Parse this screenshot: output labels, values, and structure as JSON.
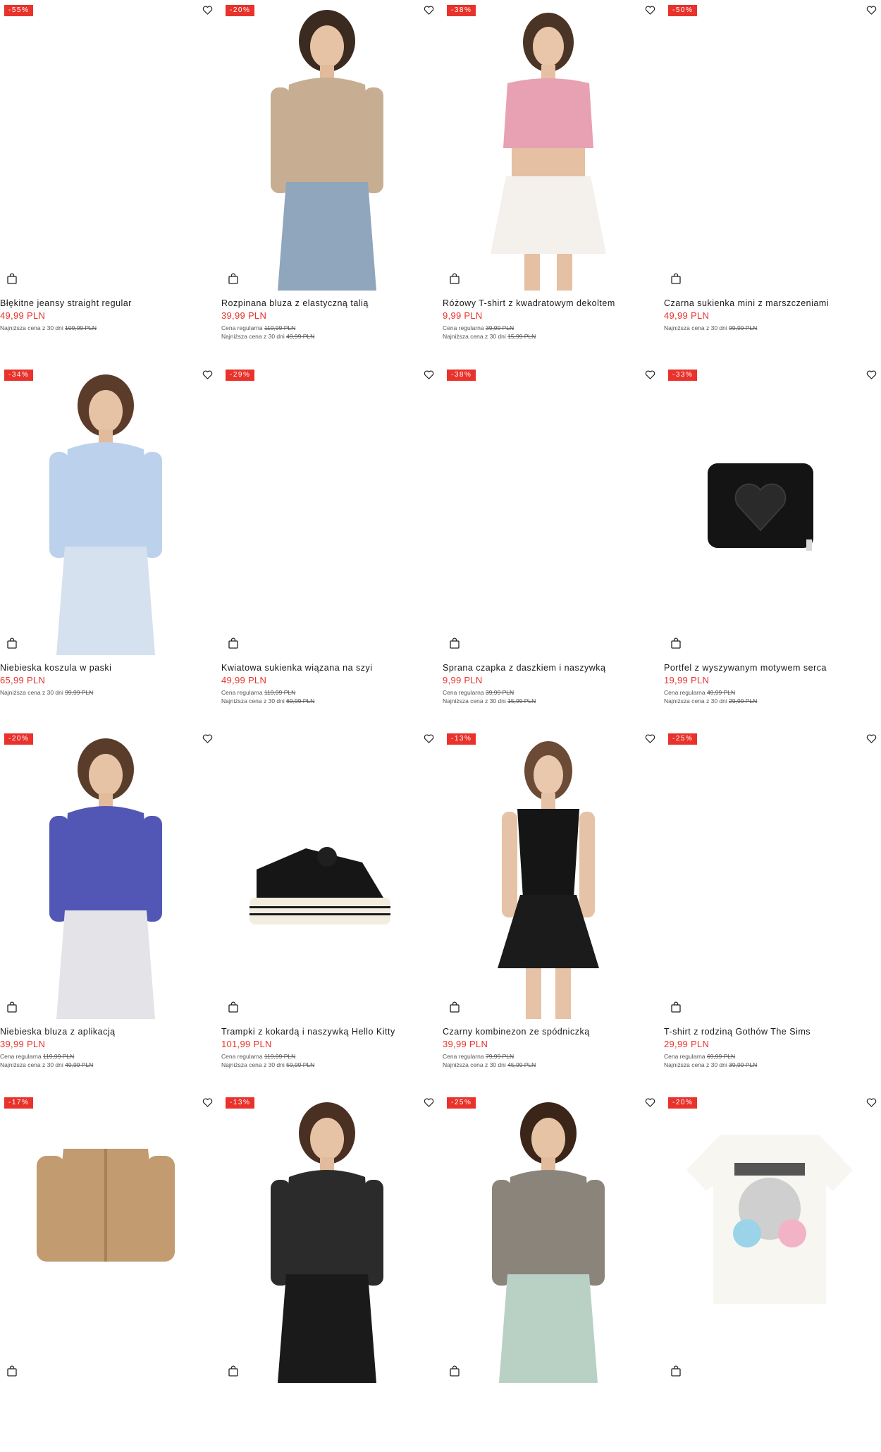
{
  "colors": {
    "sale": "#e8322b",
    "text": "#1a1a1a",
    "muted": "#555555"
  },
  "icons": {
    "favorite": "heart-outline-icon",
    "cart": "shopping-bag-icon"
  },
  "products": [
    {
      "badge": "-55%",
      "title": "Błękitne jeansy straight regular",
      "price": "49,99 PLN",
      "regular_label": "",
      "regular_price": "",
      "lowest_label": "Najniższa cena z 30 dni",
      "lowest_price": "109,99 PLN",
      "image": "empty"
    },
    {
      "badge": "-20%",
      "title": "Rozpinana bluza z elastyczną talią",
      "price": "39,99 PLN",
      "regular_label": "Cena regularna",
      "regular_price": "119,99 PLN",
      "lowest_label": "Najniższa cena z 30 dni",
      "lowest_price": "49,99 PLN",
      "image": "hoodie-model"
    },
    {
      "badge": "-38%",
      "title": "Różowy T-shirt z kwadratowym dekoltem",
      "price": "9,99 PLN",
      "regular_label": "Cena regularna",
      "regular_price": "39,99 PLN",
      "lowest_label": "Najniższa cena z 30 dni",
      "lowest_price": "15,99 PLN",
      "image": "pink-tee-model"
    },
    {
      "badge": "-50%",
      "title": "Czarna sukienka mini z marszczeniami",
      "price": "49,99 PLN",
      "regular_label": "",
      "regular_price": "",
      "lowest_label": "Najniższa cena z 30 dni",
      "lowest_price": "99,99 PLN",
      "image": "empty"
    },
    {
      "badge": "-34%",
      "title": "Niebieska koszula w paski",
      "price": "65,99 PLN",
      "regular_label": "",
      "regular_price": "",
      "lowest_label": "Najniższa cena z 30 dni",
      "lowest_price": "99,99 PLN",
      "image": "blue-shirt-model"
    },
    {
      "badge": "-29%",
      "title": "Kwiatowa sukienka wiązana na szyi",
      "price": "49,99 PLN",
      "regular_label": "Cena regularna",
      "regular_price": "119,99 PLN",
      "lowest_label": "Najniższa cena z 30 dni",
      "lowest_price": "69,99 PLN",
      "image": "empty"
    },
    {
      "badge": "-38%",
      "title": "Sprana czapka z daszkiem i naszywką",
      "price": "9,99 PLN",
      "regular_label": "Cena regularna",
      "regular_price": "39,99 PLN",
      "lowest_label": "Najniższa cena z 30 dni",
      "lowest_price": "15,99 PLN",
      "image": "empty"
    },
    {
      "badge": "-33%",
      "title": "Portfel z wyszywanym motywem serca",
      "price": "19,99 PLN",
      "regular_label": "Cena regularna",
      "regular_price": "49,99 PLN",
      "lowest_label": "Najniższa cena z 30 dni",
      "lowest_price": "29,99 PLN",
      "image": "heart-wallet"
    },
    {
      "badge": "-20%",
      "title": "Niebieska bluza z aplikacją",
      "price": "39,99 PLN",
      "regular_label": "Cena regularna",
      "regular_price": "119,99 PLN",
      "lowest_label": "Najniższa cena z 30 dni",
      "lowest_price": "49,99 PLN",
      "image": "purple-sweatshirt-model"
    },
    {
      "badge": "",
      "title": "Trampki z kokardą i naszywką Hello Kitty",
      "price": "101,99 PLN",
      "regular_label": "Cena regularna",
      "regular_price": "119,99 PLN",
      "lowest_label": "Najniższa cena z 30 dni",
      "lowest_price": "59,99 PLN",
      "image": "sneaker"
    },
    {
      "badge": "-13%",
      "title": "Czarny kombinezon ze spódniczką",
      "price": "39,99 PLN",
      "regular_label": "Cena regularna",
      "regular_price": "79,99 PLN",
      "lowest_label": "Najniższa cena z 30 dni",
      "lowest_price": "45,99 PLN",
      "image": "black-dress-model"
    },
    {
      "badge": "-25%",
      "title": "T-shirt z rodziną Gothów The Sims",
      "price": "29,99 PLN",
      "regular_label": "Cena regularna",
      "regular_price": "69,99 PLN",
      "lowest_label": "Najniższa cena z 30 dni",
      "lowest_price": "39,99 PLN",
      "image": "empty"
    },
    {
      "badge": "-17%",
      "title": "",
      "price": "",
      "regular_label": "",
      "regular_price": "",
      "lowest_label": "",
      "lowest_price": "",
      "image": "beige-jacket"
    },
    {
      "badge": "-13%",
      "title": "",
      "price": "",
      "regular_label": "",
      "regular_price": "",
      "lowest_label": "",
      "lowest_price": "",
      "image": "black-graphic-tee-model"
    },
    {
      "badge": "-25%",
      "title": "",
      "price": "",
      "regular_label": "",
      "regular_price": "",
      "lowest_label": "",
      "lowest_price": "",
      "image": "grey-tee-model"
    },
    {
      "badge": "-20%",
      "title": "",
      "price": "",
      "regular_label": "",
      "regular_price": "",
      "lowest_label": "",
      "lowest_price": "",
      "image": "metallica-tee"
    }
  ]
}
